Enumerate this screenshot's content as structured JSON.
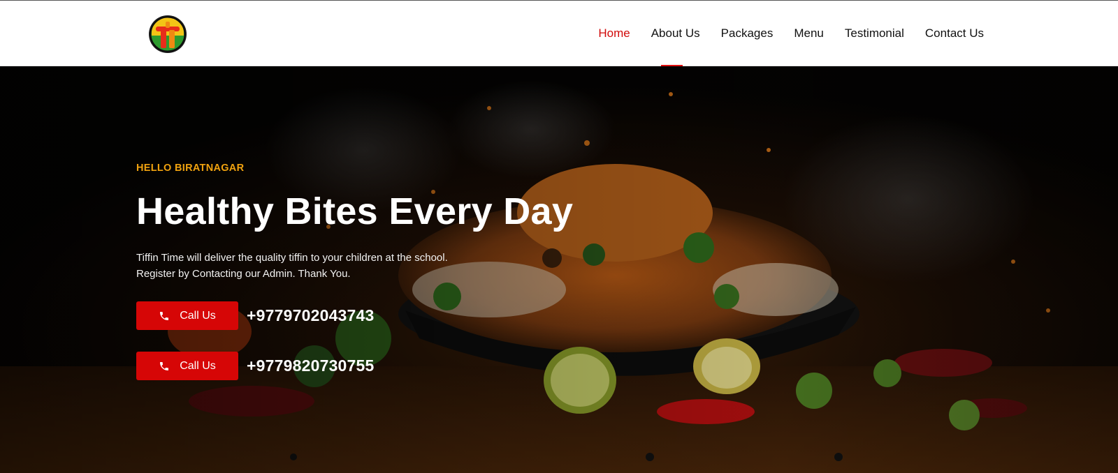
{
  "header": {
    "logo_icon": "tiffin-time-logo",
    "nav": [
      {
        "label": "Home",
        "active": true
      },
      {
        "label": "About Us",
        "active": false
      },
      {
        "label": "Packages",
        "active": false
      },
      {
        "label": "Menu",
        "active": false
      },
      {
        "label": "Testimonial",
        "active": false
      },
      {
        "label": "Contact Us",
        "active": false
      }
    ],
    "active_color": "#d10a0a"
  },
  "hero": {
    "background_icon": "food-bowl-photo",
    "eyebrow": "HELLO BIRATNAGAR",
    "title": "Healthy Bites Every Day",
    "description_line1": "Tiffin Time will deliver the quality tiffin to your children at the school.",
    "description_line2": "Register by Contacting our Admin. Thank You.",
    "calls": [
      {
        "button_label": "Call Us",
        "icon": "phone-icon",
        "number": "+9779702043743"
      },
      {
        "button_label": "Call Us",
        "icon": "phone-icon",
        "number": "+9779820730755"
      }
    ],
    "accent_color": "#f0a20f",
    "button_color": "#d60606"
  }
}
